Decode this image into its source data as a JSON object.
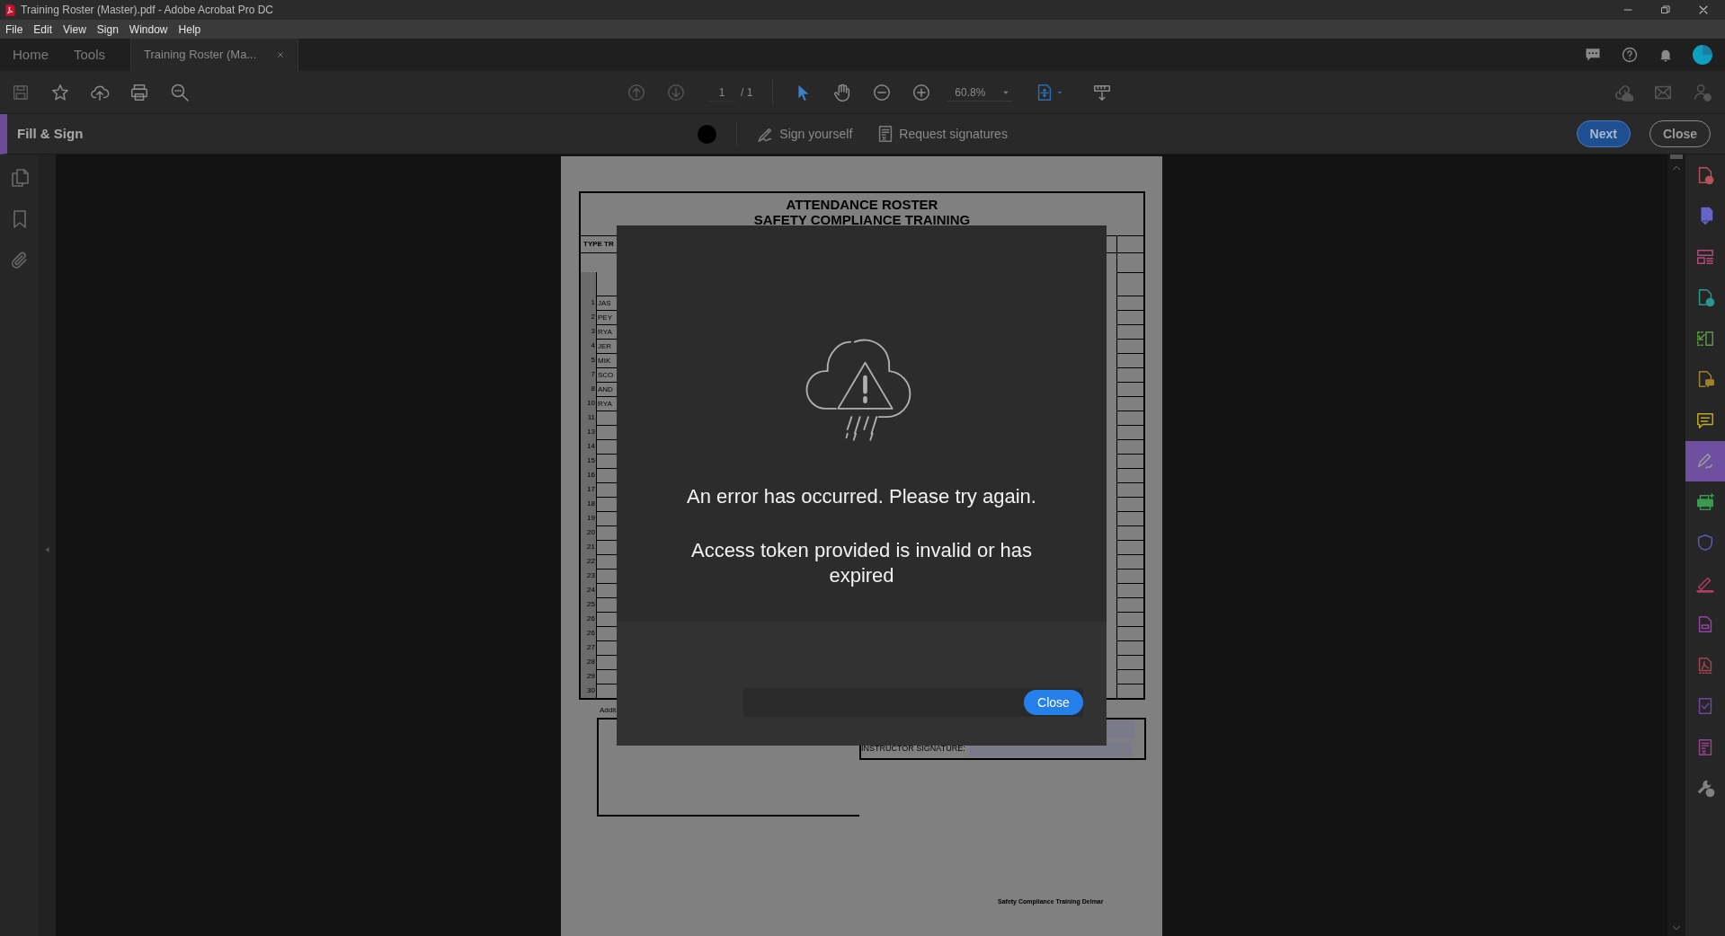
{
  "window": {
    "title": "Training Roster (Master).pdf - Adobe Acrobat Pro DC"
  },
  "menu": [
    "File",
    "Edit",
    "View",
    "Sign",
    "Window",
    "Help"
  ],
  "tabs": [
    {
      "label": "Home",
      "selected": false
    },
    {
      "label": "Tools",
      "selected": false
    },
    {
      "label": "Training Roster (Ma...",
      "selected": true
    }
  ],
  "toolbar": {
    "page_current": "1",
    "page_total": "/ 1",
    "zoom": "60.8%",
    "view_tools": [
      {
        "kind": "select",
        "selected": true
      },
      {
        "kind": "hand",
        "selected": false
      }
    ]
  },
  "fill_sign": {
    "title": "Fill & Sign",
    "sign_yourself": "Sign yourself",
    "request_signatures": "Request signatures",
    "buttons": [
      {
        "label": "Next",
        "kind": "primary"
      },
      {
        "label": "Close",
        "kind": "outline"
      }
    ]
  },
  "document": {
    "title_lines": [
      "ATTENDANCE ROSTER",
      "SAFETY COMPLIANCE TRAINING"
    ],
    "type_label": "TYPE TR",
    "rows": [
      {
        "number": "1",
        "name": "JAS"
      },
      {
        "number": "2",
        "name": "PEY"
      },
      {
        "number": "3",
        "name": "RYA"
      },
      {
        "number": "4",
        "name": "JER"
      },
      {
        "number": "5",
        "name": "MIK"
      },
      {
        "number": "7",
        "name": "SCO"
      },
      {
        "number": "8",
        "name": "AND"
      },
      {
        "number": "10",
        "name": "RYA"
      },
      {
        "number": "11"
      },
      {
        "number": "13"
      },
      {
        "number": "14"
      },
      {
        "number": "15"
      },
      {
        "number": "16"
      },
      {
        "number": "17"
      },
      {
        "number": "18"
      },
      {
        "number": "19"
      },
      {
        "number": "20"
      },
      {
        "number": "21"
      },
      {
        "number": "22"
      },
      {
        "number": "23"
      },
      {
        "number": "24"
      },
      {
        "number": "25"
      },
      {
        "number": "26"
      },
      {
        "number": "26"
      },
      {
        "number": "27"
      },
      {
        "number": "28"
      },
      {
        "number": "29"
      },
      {
        "number": "30"
      }
    ],
    "additional_label": "Addit",
    "instructor_label": "INSTRUCTOR SIGNATURE:",
    "footer": "Safety Compliance Training Delmar"
  },
  "dialog": {
    "heading": "An error has occurred. Please try again.",
    "message": "Access token provided is invalid or has expired",
    "button": "Close"
  },
  "tools_rail": [
    {
      "kind": "doc-plus",
      "color": "#b8525a",
      "selected": false
    },
    {
      "kind": "doc-down",
      "color": "#6664c8",
      "selected": false
    },
    {
      "kind": "layout",
      "color": "#b04a80",
      "selected": false
    },
    {
      "kind": "doc-arrow",
      "color": "#2a978c",
      "selected": false
    },
    {
      "kind": "organize",
      "color": "#5a9a44",
      "selected": false
    },
    {
      "kind": "doc-comment",
      "color": "#a08028",
      "selected": false
    },
    {
      "kind": "comment",
      "color": "#c0a828",
      "selected": false
    },
    {
      "kind": "sign",
      "color": "#9a9a9a",
      "selected": true
    },
    {
      "kind": "print",
      "color": "#3a9a52",
      "selected": false
    },
    {
      "kind": "shield",
      "color": "#5a5ab0",
      "selected": false
    },
    {
      "kind": "highlighter",
      "color": "#b03a64",
      "selected": false
    },
    {
      "kind": "doc-form",
      "color": "#9444a4",
      "selected": false
    },
    {
      "kind": "doc-pdf",
      "color": "#a44452",
      "selected": false
    },
    {
      "kind": "doc-check",
      "color": "#7044a4",
      "selected": false
    },
    {
      "kind": "doc-list",
      "color": "#94448c",
      "selected": false
    },
    {
      "kind": "wrench",
      "color": "#808080",
      "selected": false
    }
  ]
}
